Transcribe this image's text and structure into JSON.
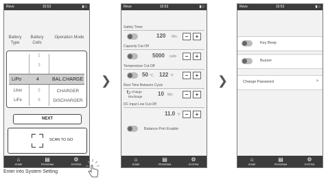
{
  "status": {
    "carrier": "Revo",
    "time": "15:53"
  },
  "nav": {
    "home": "HOME",
    "program": "PROGRAM",
    "system": "SYSTEM"
  },
  "screen1": {
    "headers": [
      "Battery Type",
      "Battery Cells",
      "Operation Mode"
    ],
    "cells_above": [
      "2",
      "3"
    ],
    "selected": {
      "type": "LiPo",
      "cells": "4",
      "mode": "BAL.CHARGE"
    },
    "types_below": [
      "LiIon",
      "LiFe"
    ],
    "cells_below": [
      "5",
      "6"
    ],
    "modes_below": [
      "CHARGER",
      "DISCHARGER"
    ],
    "next_label": "NEXT",
    "scan_label": "SCAN TO GO"
  },
  "screen2": {
    "safety_timer": {
      "label": "Safety Timer",
      "value": "120",
      "unit": "Min"
    },
    "capacity_cutoff": {
      "label": "Capacity Cut-Off",
      "value": "5000",
      "unit": "mAh"
    },
    "temperature_cutoff": {
      "label": "Temperature Cut-Off",
      "value_c": "50",
      "unit_c": "°C",
      "value_f": "122",
      "unit_f": "°F"
    },
    "rest_time": {
      "label": "Rest Time Between Cycle",
      "charge": "Charge",
      "discharge": "Discharge",
      "value": "10",
      "unit": "Min"
    },
    "dc_input": {
      "label": "DC Input Low Cut-Off",
      "value": "11.0",
      "unit": "V"
    },
    "balance_port": {
      "label": "Balance Port Enable"
    },
    "minus": "−",
    "plus": "+"
  },
  "screen3": {
    "key_beep": "Key Beep",
    "buzzer": "Buzzer",
    "change_password": "Change Password",
    "arrow": ">"
  },
  "caption": "Enter into System Setting"
}
